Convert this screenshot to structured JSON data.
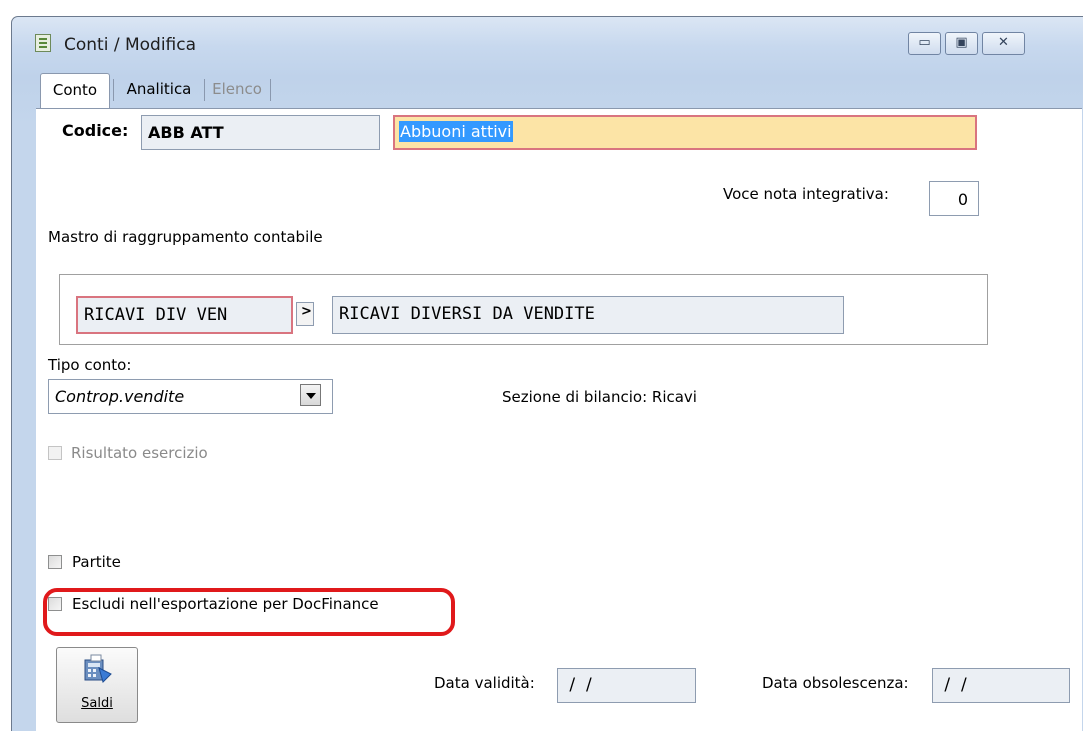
{
  "window": {
    "title": "Conti / Modifica",
    "controls": {
      "minimize": "▭",
      "maximize": "▣",
      "close": "✕"
    }
  },
  "tabs": [
    {
      "label": "Conto",
      "active": true
    },
    {
      "label": "Analitica",
      "active": false
    },
    {
      "label": "Elenco",
      "active": false,
      "disabled": true
    }
  ],
  "form": {
    "codice_label": "Codice:",
    "codice_value": "ABB ATT",
    "descrizione_value": "Abbuoni attivi",
    "voce_nota_label": "Voce nota integrativa:",
    "voce_nota_value": "0",
    "mastro_label": "Mastro di raggruppamento contabile",
    "mastro_code": "RICAVI DIV VEN",
    "mastro_desc": "RICAVI DIVERSI DA VENDITE",
    "zoom_glyph": ">",
    "tipo_conto_label": "Tipo conto:",
    "tipo_conto_value": "Controp.vendite",
    "sezione_bilancio": "Sezione di bilancio: Ricavi",
    "risultato_esercizio_label": "Risultato esercizio",
    "partite_label": "Partite",
    "escludi_label": "Escludi nell'esportazione per DocFinance",
    "data_validita_label": "Data validità:",
    "data_validita_value": " /  /",
    "data_obsolescenza_label": "Data obsolescenza:",
    "data_obsolescenza_value": " /  /"
  },
  "buttons": {
    "saldi_label": "Saldi"
  },
  "colors": {
    "description_bg": "#fce4a6",
    "description_selection": "#3399ff",
    "required_border": "#d9747f",
    "highlight_ring": "#e0191b"
  }
}
